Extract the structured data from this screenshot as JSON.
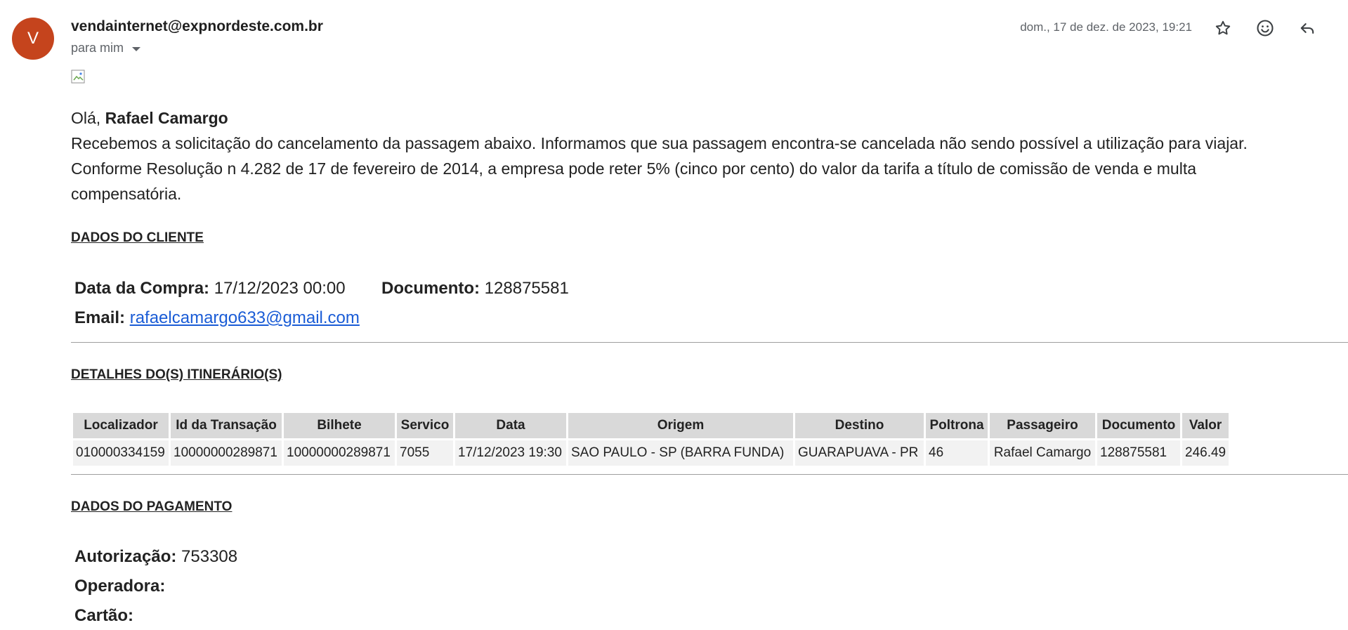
{
  "email": {
    "avatar_letter": "V",
    "avatar_color": "#c5441d",
    "sender": "vendainternet@expnordeste.com.br",
    "recipient": "para mim",
    "datetime": "dom., 17 de dez. de 2023, 19:21",
    "icons": [
      "star-icon",
      "emoji-icon",
      "reply-icon"
    ]
  },
  "body": {
    "greeting_prefix": "Olá,",
    "greeting_name": "Rafael Camargo",
    "paragraph1": "Recebemos a solicitação do cancelamento da passagem abaixo. Informamos que sua passagem encontra-se cancelada não sendo possível a utilização para viajar.",
    "paragraph2_line1": "Conforme Resolução n 4.282 de 17 de fevereiro de 2014, a empresa pode reter 5% (cinco por cento) do valor da tarifa a título de comissão de venda e multa",
    "paragraph2_line2": "compensatória."
  },
  "client": {
    "title": "DADOS DO CLIENTE",
    "purchase_label": "Data da Compra:",
    "purchase_value": "17/12/2023 00:00",
    "document_label": "Documento:",
    "document_value": "128875581",
    "email_label": "Email:",
    "email_value": "rafaelcamargo633@gmail.com"
  },
  "itinerary": {
    "title": "DETALHES DO(S) ITINERÁRIO(S)",
    "headers": [
      "Localizador",
      "Id da Transação",
      "Bilhete",
      "Servico",
      "Data",
      "Origem",
      "Destino",
      "Poltrona",
      "Passageiro",
      "Documento",
      "Valor"
    ],
    "rows": [
      [
        "010000334159",
        "10000000289871",
        "10000000289871",
        "7055",
        "17/12/2023 19:30",
        "SAO PAULO - SP (BARRA FUNDA)",
        "GUARAPUAVA - PR",
        "46",
        "Rafael Camargo",
        "128875581",
        "246.49"
      ]
    ]
  },
  "payment": {
    "title": "DADOS DO PAGAMENTO",
    "auth_label": "Autorização:",
    "auth_value": "753308",
    "operator_label": "Operadora:",
    "operator_value": "",
    "card_label": "Cartão:",
    "card_value": ""
  }
}
